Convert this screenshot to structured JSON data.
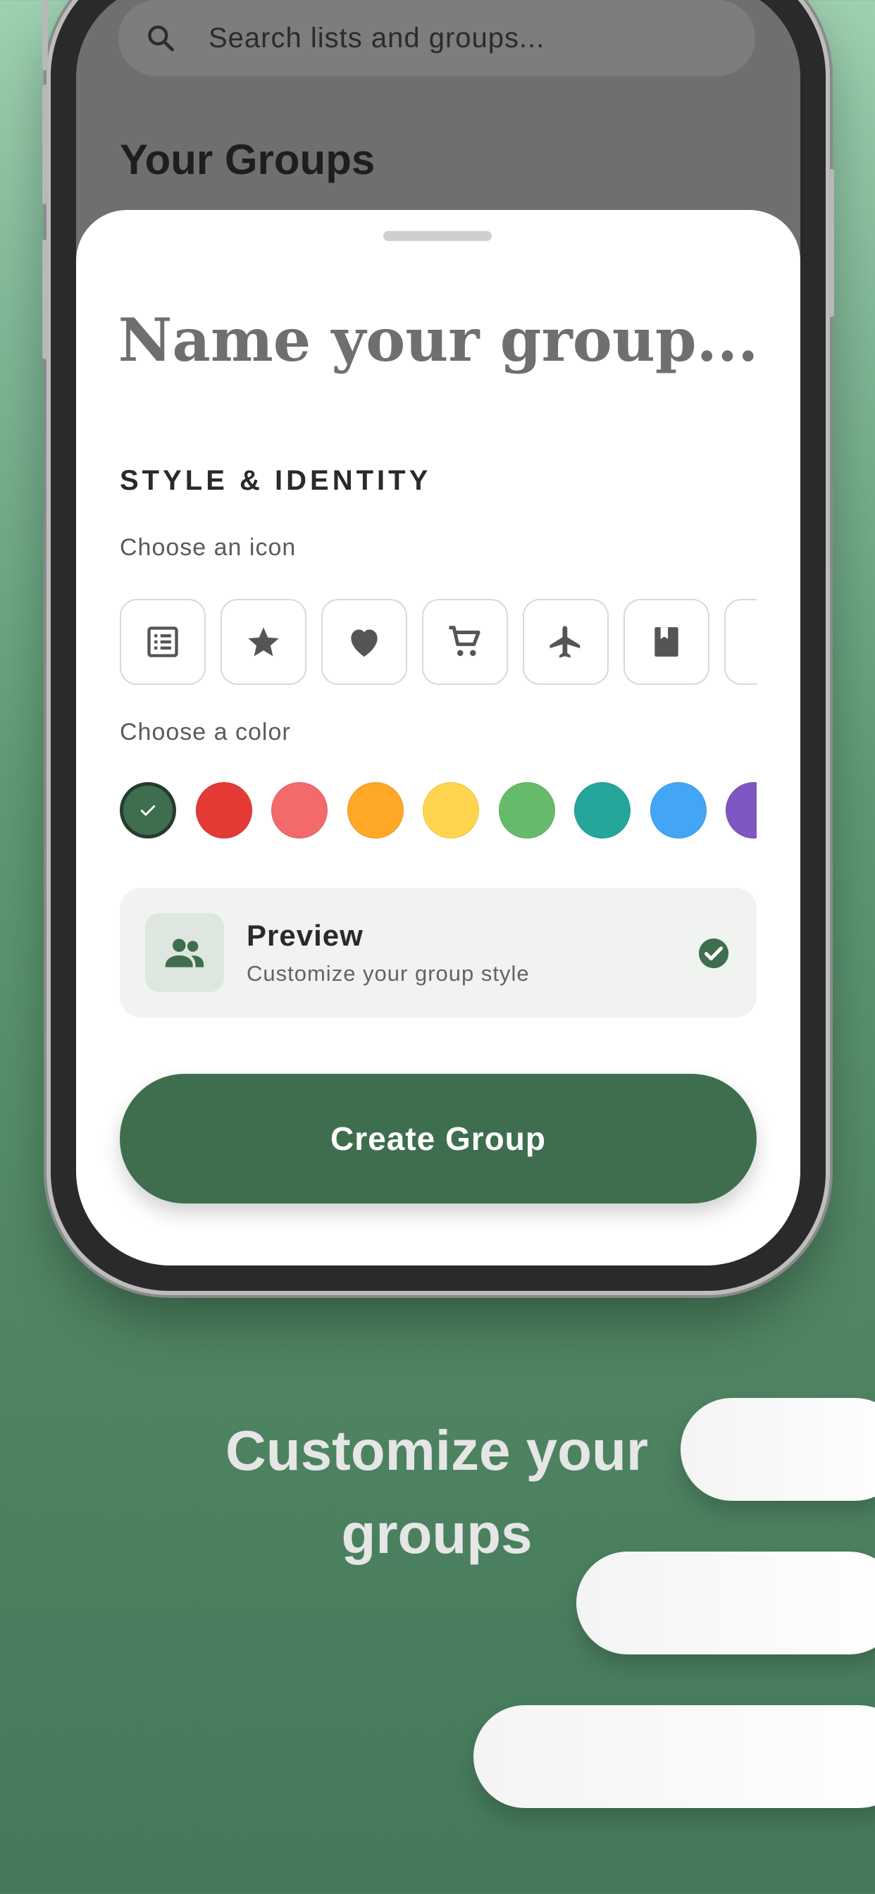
{
  "search": {
    "placeholder": "Search lists and groups..."
  },
  "background_section": {
    "title": "Your Groups"
  },
  "sheet": {
    "name_placeholder": "Name your group...",
    "section_title": "STYLE & IDENTITY",
    "icon_label": "Choose an icon",
    "icons": [
      "list-icon",
      "star-icon",
      "heart-icon",
      "cart-icon",
      "airplane-icon",
      "book-icon",
      "more-icon"
    ],
    "color_label": "Choose a color",
    "colors": [
      "#3f6e4f",
      "#e53935",
      "#f46a6a",
      "#ffa726",
      "#ffd54f",
      "#66bb6a",
      "#26a69a",
      "#42a5f5",
      "#7e57c2"
    ],
    "selected_color_index": 0,
    "preview": {
      "title": "Preview",
      "subtitle": "Customize your group style"
    },
    "create_button": "Create Group"
  },
  "promo": {
    "line1": "Customize your",
    "line2": "groups"
  }
}
